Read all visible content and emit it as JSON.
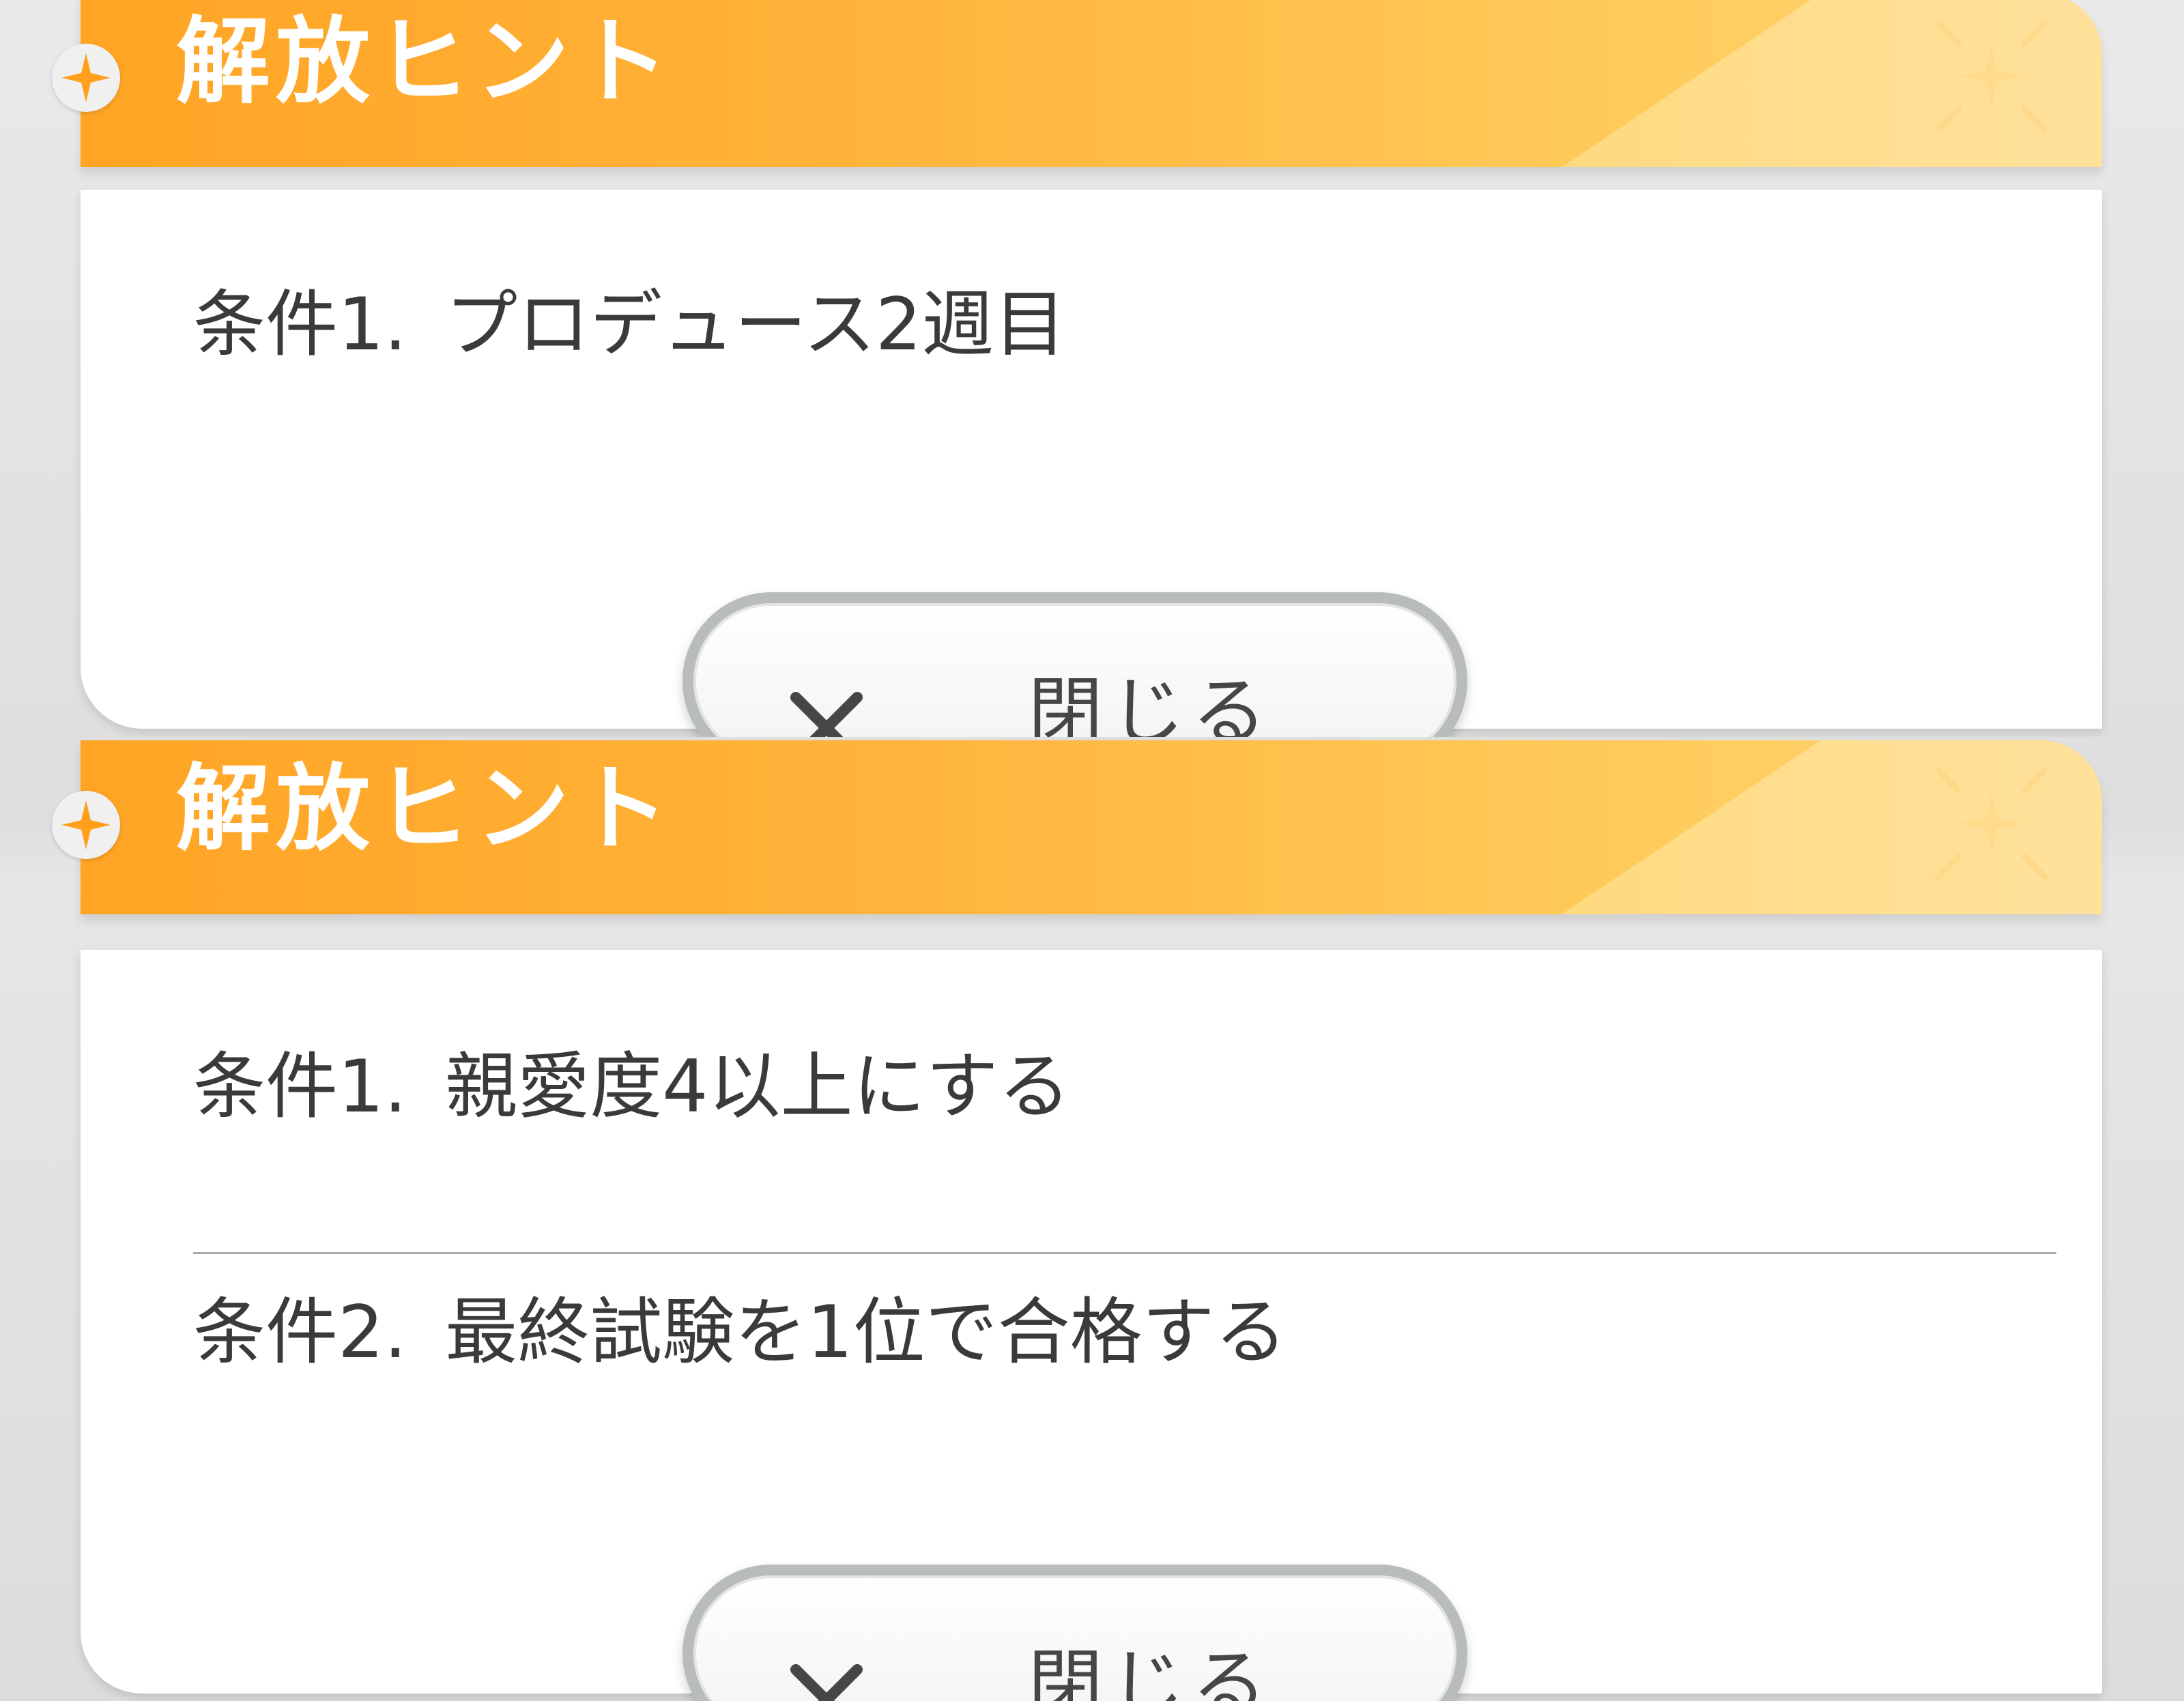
{
  "hints": [
    {
      "title": "解放ヒント",
      "conditions": [
        {
          "label": "条件1.",
          "text": "プロデュース2週目"
        }
      ],
      "close_label": "閉じる"
    },
    {
      "title": "解放ヒント",
      "conditions": [
        {
          "label": "条件1.",
          "text": "親愛度4以上にする"
        },
        {
          "label": "条件2.",
          "text": "最終試験を1位で合格する"
        }
      ],
      "close_label": "閉じる"
    }
  ],
  "icons": {
    "header_badge": "sparkle-icon",
    "header_decoration": "sparkle-burst-icon",
    "close": "close-x-icon"
  },
  "colors": {
    "accent": "#ffa424",
    "accent_light": "#ffd779",
    "sparkle": "#ff9f1c",
    "text": "#3a3a3a",
    "card": "#ffffff"
  }
}
